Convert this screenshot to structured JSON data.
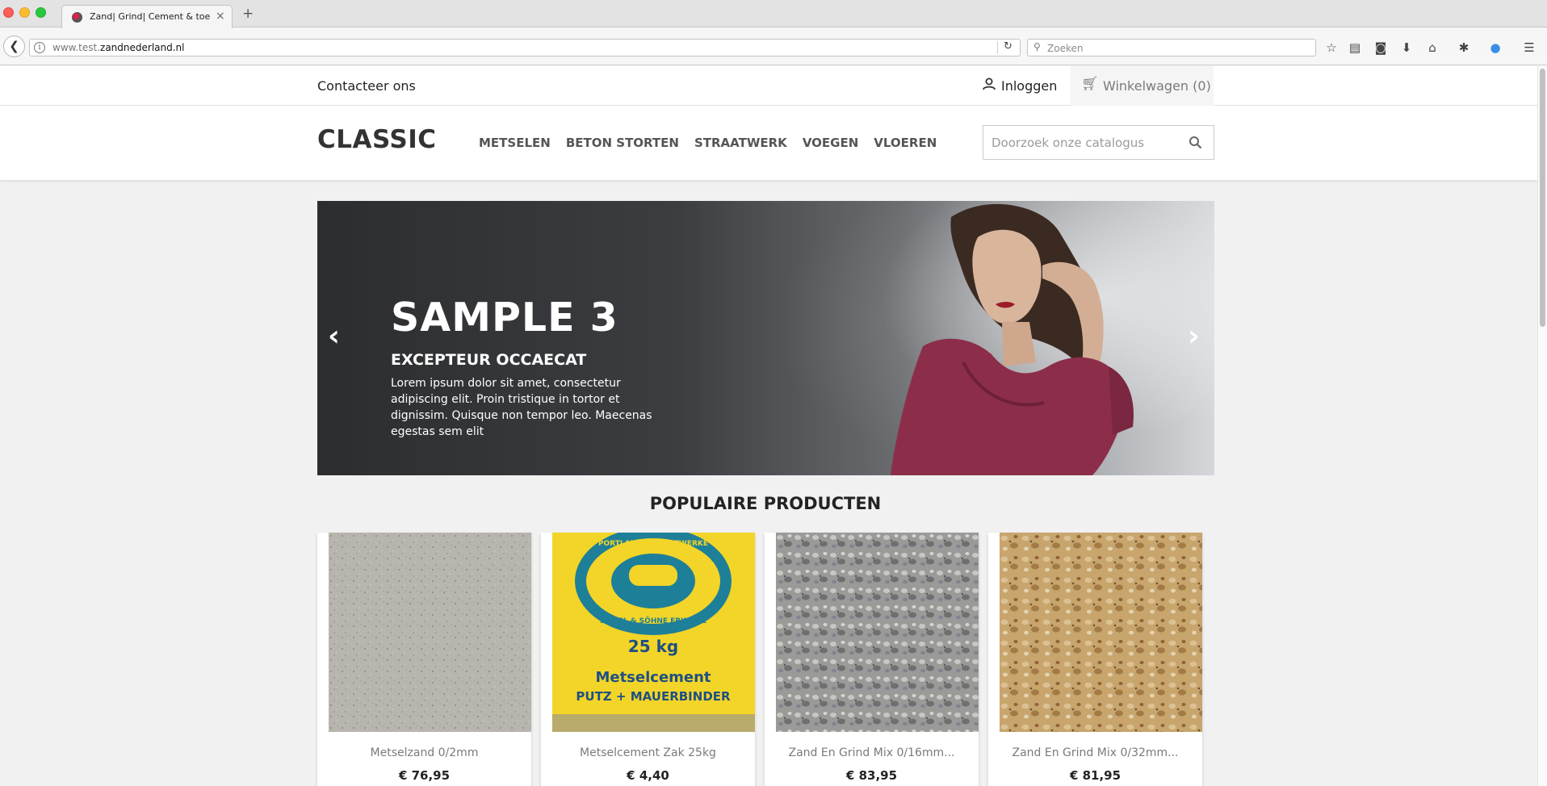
{
  "browser": {
    "tab_title": "Zand| Grind| Cement & toebe",
    "tab_close": "×",
    "new_tab": "+",
    "back": "❮",
    "url_prefix": "www.test.",
    "url_domain": "zandnederland.nl",
    "search_placeholder": "Zoeken"
  },
  "topnav": {
    "contact": "Contacteer ons",
    "login": "Inloggen",
    "cart": "Winkelwagen (0)"
  },
  "header": {
    "logo": "CLASSIC",
    "menu": [
      "METSELEN",
      "BETON STORTEN",
      "STRAATWERK",
      "VOEGEN",
      "VLOEREN"
    ],
    "search_placeholder": "Doorzoek onze catalogus"
  },
  "hero": {
    "title": "SAMPLE 3",
    "subtitle": "EXCEPTEUR OCCAECAT",
    "text": "Lorem ipsum dolor sit amet, consectetur adipiscing elit. Proin tristique in tortor et dignissim. Quisque non tempor leo. Maecenas egestas sem elit",
    "prev": "‹",
    "next": "›"
  },
  "section_title": "POPULAIRE PRODUCTEN",
  "products": [
    {
      "name": "Metselzand 0/2mm",
      "price": "€ 76,95",
      "image": "grey-sand"
    },
    {
      "name": "Metselcement Zak 25kg",
      "price": "€ 4,40",
      "image": "cement-bag"
    },
    {
      "name": "Zand En Grind Mix 0/16mm...",
      "price": "€ 83,95",
      "image": "grey-gravel"
    },
    {
      "name": "Zand En Grind Mix 0/32mm...",
      "price": "€ 81,95",
      "image": "yellow-gravel"
    }
  ],
  "cement_bag": {
    "brand_ring": "PORTLAND-ZEMENTWERKE",
    "maker": "SEIBEL & SÖHNE ERWITTE",
    "weight": "25 kg",
    "line1": "Metselcement",
    "line2": "PUTZ + MAUERBINDER"
  }
}
